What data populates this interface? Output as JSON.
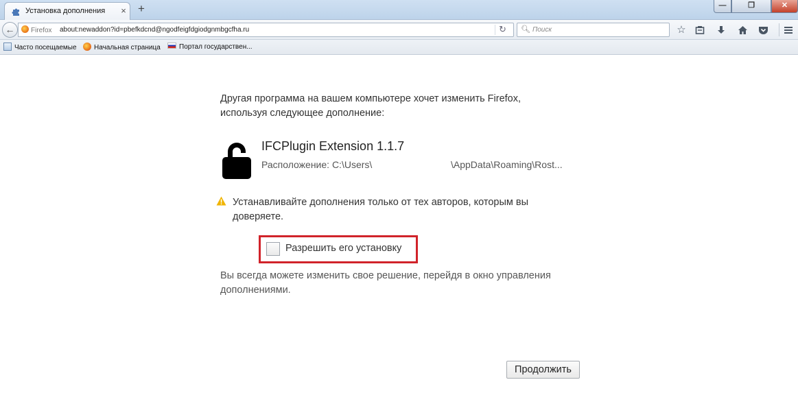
{
  "tab": {
    "title": "Установка дополнения",
    "close": "×",
    "new_tab": "+"
  },
  "window_controls": {
    "minimize": "—",
    "restore": "❐",
    "close": "✕"
  },
  "navbar": {
    "identity_label": "Firefox",
    "url": "about:newaddon?id=pbefkdcnd@ngodfeigfdgiodgnmbgcfha.ru",
    "search_placeholder": "Поиск"
  },
  "bookmarks": [
    {
      "label": "Часто посещаемые",
      "icon": "most-visited-icon"
    },
    {
      "label": "Начальная страница",
      "icon": "firefox-icon"
    },
    {
      "label": "Портал государствен...",
      "icon": "russia-flag-icon"
    }
  ],
  "page": {
    "intro": "Другая программа на вашем компьютере хочет изменить Firefox, используя следующее дополнение:",
    "addon_name": "IFCPlugin Extension 1.1.7",
    "addon_location_label": "Расположение: C:\\Users\\",
    "addon_location_tail": "\\AppData\\Roaming\\Rost...",
    "warning": "Устанавливайте дополнения только от тех авторов, которым вы доверяете.",
    "allow_label": "Разрешить его установку",
    "allow_checked": false,
    "note": "Вы всегда можете изменить свое решение, перейдя в окно управления дополнениями.",
    "continue_label": "Продолжить"
  },
  "colors": {
    "highlight_border": "#d1232a",
    "warning_icon": "#f0b400"
  }
}
